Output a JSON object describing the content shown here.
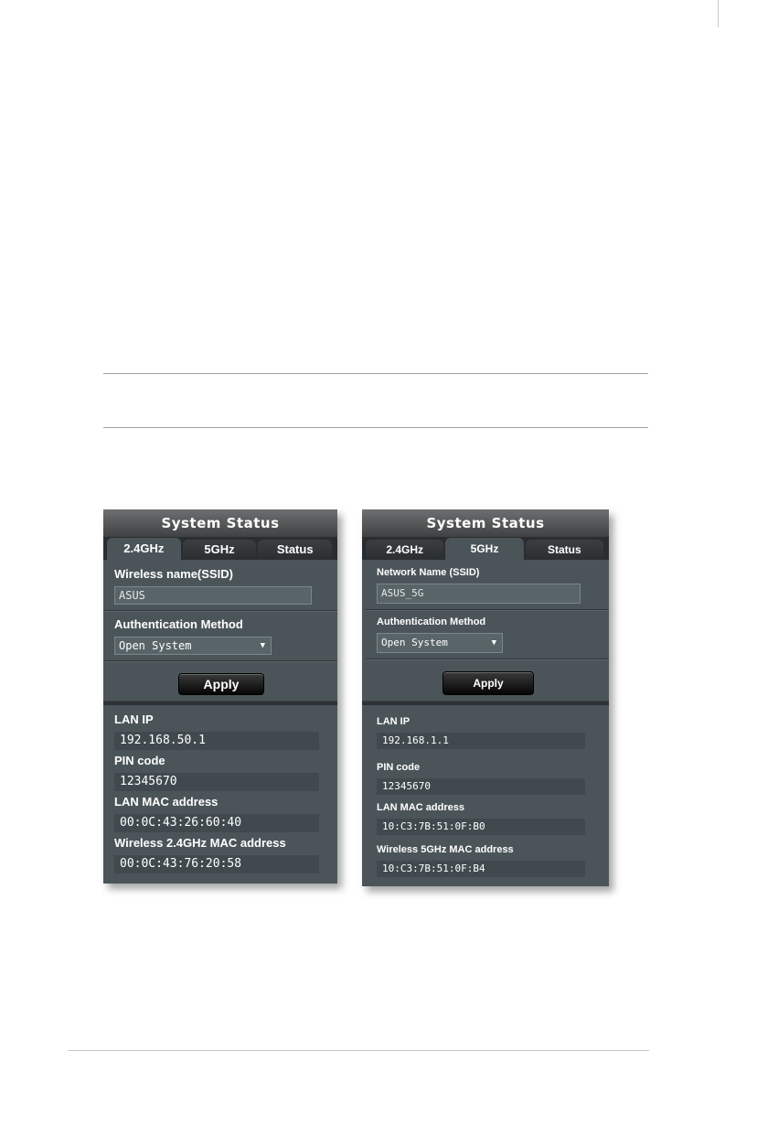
{
  "left_panel": {
    "title": "System Status",
    "tabs": [
      {
        "label": "2.4GHz",
        "active": true
      },
      {
        "label": "5GHz",
        "active": false
      },
      {
        "label": "Status",
        "active": false
      }
    ],
    "ssid_label": "Wireless name(SSID)",
    "ssid_value": "ASUS",
    "auth_label": "Authentication Method",
    "auth_selected": "Open System",
    "apply_label": "Apply",
    "info": [
      {
        "label": "LAN IP",
        "value": "192.168.50.1"
      },
      {
        "label": "PIN code",
        "value": "12345670"
      },
      {
        "label": "LAN MAC address",
        "value": "00:0C:43:26:60:40"
      },
      {
        "label": "Wireless 2.4GHz MAC address",
        "value": "00:0C:43:76:20:58"
      }
    ]
  },
  "right_panel": {
    "title": "System Status",
    "tabs": [
      {
        "label": "2.4GHz",
        "active": false
      },
      {
        "label": "5GHz",
        "active": true
      },
      {
        "label": "Status",
        "active": false
      }
    ],
    "ssid_label": "Network Name (SSID)",
    "ssid_value": "ASUS_5G",
    "auth_label": "Authentication Method",
    "auth_selected": "Open System",
    "apply_label": "Apply",
    "info": [
      {
        "label": "LAN IP",
        "value": "192.168.1.1"
      },
      {
        "label": "PIN code",
        "value": "12345670"
      },
      {
        "label": "LAN MAC address",
        "value": "10:C3:7B:51:0F:B0"
      },
      {
        "label": "Wireless 5GHz MAC address",
        "value": "10:C3:7B:51:0F:B4"
      }
    ]
  },
  "icons": {
    "dropdown": "triangle-down-icon"
  }
}
